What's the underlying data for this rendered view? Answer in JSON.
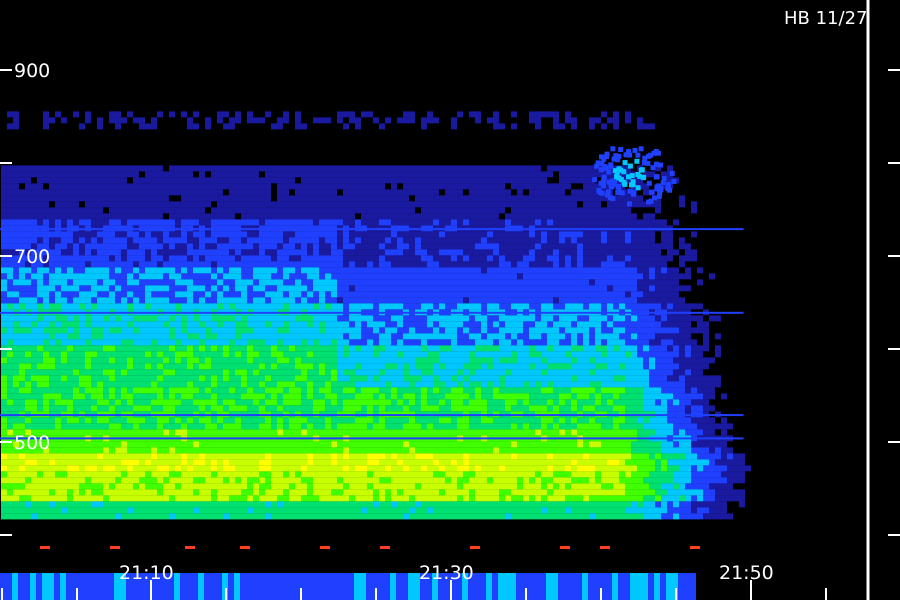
{
  "header": {
    "stamp": "HB 11/27"
  },
  "chart_data": {
    "type": "heatmap",
    "title": "",
    "xlabel": "",
    "ylabel": "",
    "x_ticks": [
      "21:10",
      "21:30",
      "21:50"
    ],
    "y_ticks": [
      900,
      700,
      500
    ],
    "ylim": [
      420,
      920
    ],
    "xlim_minutes": [
      "21:00",
      "21:58"
    ],
    "grid": false,
    "colormap": [
      "#000000",
      "#1a1aa0",
      "#2040ff",
      "#00c8ff",
      "#00e070",
      "#40ff00",
      "#c8ff00",
      "#ffff00",
      "#ff9000"
    ],
    "bands": [
      {
        "from": 420,
        "to": 440,
        "level": 0.55
      },
      {
        "from": 440,
        "to": 470,
        "level": 0.78
      },
      {
        "from": 470,
        "to": 490,
        "level": 0.84
      },
      {
        "from": 490,
        "to": 520,
        "level": 0.7
      },
      {
        "from": 520,
        "to": 560,
        "level": 0.62
      },
      {
        "from": 560,
        "to": 610,
        "level": 0.6
      },
      {
        "from": 610,
        "to": 650,
        "level": 0.48
      },
      {
        "from": 650,
        "to": 690,
        "level": 0.38
      },
      {
        "from": 690,
        "to": 740,
        "level": 0.28
      },
      {
        "from": 740,
        "to": 800,
        "level": 0.18
      },
      {
        "from": 800,
        "to": 840,
        "level": 0.06
      },
      {
        "from": 840,
        "to": 860,
        "level": 0.12
      },
      {
        "from": 860,
        "to": 920,
        "level": 0.02
      }
    ]
  }
}
